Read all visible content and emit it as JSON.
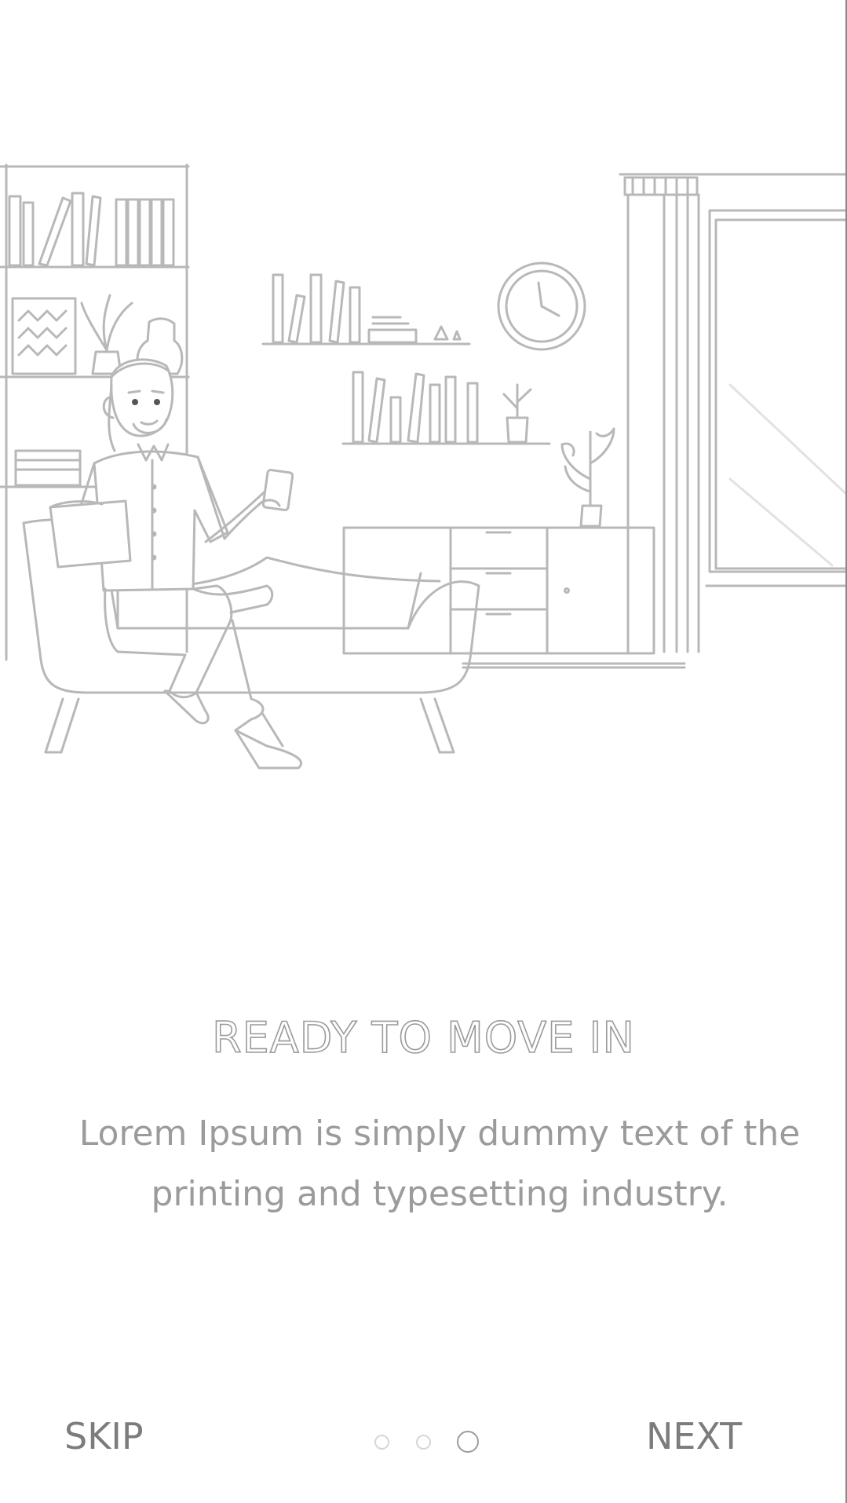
{
  "onboarding": {
    "illustration": "living-room-man-on-sofa-with-phone",
    "title": "READY TO MOVE IN",
    "description": "Lorem Ipsum is simply dummy text of the printing and typesetting industry.",
    "skip_label": "SKIP",
    "next_label": "NEXT",
    "page_indicator": {
      "total": 3,
      "current": 3
    }
  },
  "colors": {
    "background": "#ffffff",
    "line_art": "#b8b8b8",
    "text": "#9b9b9b",
    "active_dot": "#9c9c9c",
    "inactive_dot": "#d6d6d6"
  }
}
